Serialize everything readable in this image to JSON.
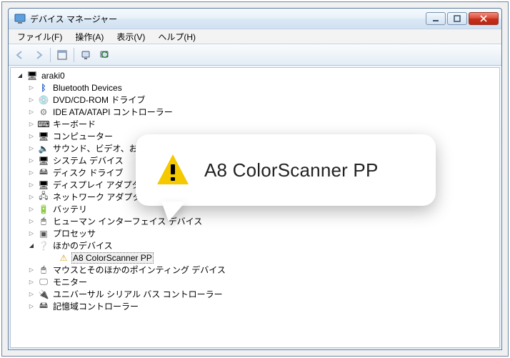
{
  "window": {
    "title": "デバイス マネージャー"
  },
  "menubar": [
    "ファイル(F)",
    "操作(A)",
    "表示(V)",
    "ヘルプ(H)"
  ],
  "toolbar_icons": [
    "back",
    "forward",
    "sep",
    "pane",
    "sep",
    "computer",
    "refresh"
  ],
  "tree": {
    "root": "araki0",
    "categories": [
      {
        "icon": "bt",
        "label": "Bluetooth Devices"
      },
      {
        "icon": "cd",
        "label": "DVD/CD-ROM ドライブ"
      },
      {
        "icon": "ide",
        "label": "IDE ATA/ATAPI コントローラー"
      },
      {
        "icon": "kb",
        "label": "キーボード"
      },
      {
        "icon": "pc",
        "label": "コンピューター"
      },
      {
        "icon": "sound",
        "label": "サウンド、ビデオ、およ"
      },
      {
        "icon": "sys",
        "label": "システム デバイス"
      },
      {
        "icon": "disk",
        "label": "ディスク ドライブ"
      },
      {
        "icon": "display",
        "label": "ディスプレイ アダプタ"
      },
      {
        "icon": "net",
        "label": "ネットワーク アダプタ"
      },
      {
        "icon": "batt",
        "label": "バッテリ"
      },
      {
        "icon": "hid",
        "label": "ヒューマン インターフェイス デバイス"
      },
      {
        "icon": "cpu",
        "label": "プロセッサ"
      },
      {
        "icon": "other",
        "label": "ほかのデバイス",
        "expanded": true,
        "children": [
          {
            "icon": "warn",
            "label": "A8 ColorScanner PP",
            "selected": true
          }
        ]
      },
      {
        "icon": "mouse",
        "label": "マウスとそのほかのポインティング デバイス"
      },
      {
        "icon": "monitor",
        "label": "モニター"
      },
      {
        "icon": "usb",
        "label": "ユニバーサル シリアル バス コントローラー"
      },
      {
        "icon": "storage",
        "label": "記憶域コントローラー"
      }
    ]
  },
  "callout": {
    "text": "A8 ColorScanner PP"
  }
}
